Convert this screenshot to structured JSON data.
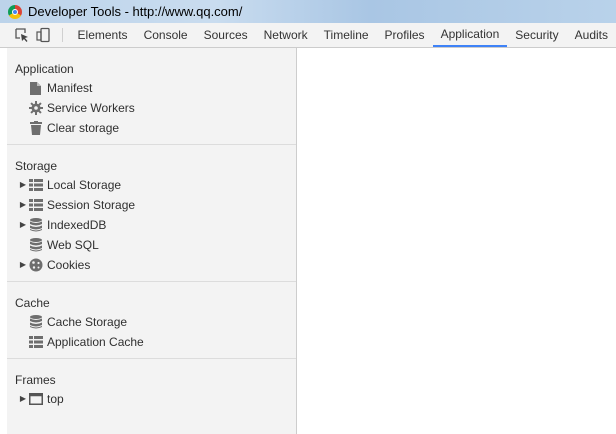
{
  "window": {
    "title": "Developer Tools - http://www.qq.com/"
  },
  "toolbar": {
    "tabs": [
      {
        "label": "Elements"
      },
      {
        "label": "Console"
      },
      {
        "label": "Sources"
      },
      {
        "label": "Network"
      },
      {
        "label": "Timeline"
      },
      {
        "label": "Profiles"
      },
      {
        "label": "Application"
      },
      {
        "label": "Security"
      },
      {
        "label": "Audits"
      }
    ],
    "active_tab": "Application",
    "accent_color": "#3e82f7"
  },
  "sidebar": {
    "sections": [
      {
        "title": "Application",
        "items": [
          {
            "label": "Manifest",
            "icon": "document-icon",
            "expandable": false
          },
          {
            "label": "Service Workers",
            "icon": "gear-icon",
            "expandable": false
          },
          {
            "label": "Clear storage",
            "icon": "trash-icon",
            "expandable": false
          }
        ]
      },
      {
        "title": "Storage",
        "items": [
          {
            "label": "Local Storage",
            "icon": "grid-icon",
            "expandable": true
          },
          {
            "label": "Session Storage",
            "icon": "grid-icon",
            "expandable": true
          },
          {
            "label": "IndexedDB",
            "icon": "database-icon",
            "expandable": true
          },
          {
            "label": "Web SQL",
            "icon": "database-icon",
            "expandable": false
          },
          {
            "label": "Cookies",
            "icon": "cookie-icon",
            "expandable": true
          }
        ]
      },
      {
        "title": "Cache",
        "items": [
          {
            "label": "Cache Storage",
            "icon": "database-icon",
            "expandable": false
          },
          {
            "label": "Application Cache",
            "icon": "grid-icon",
            "expandable": false
          }
        ]
      },
      {
        "title": "Frames",
        "items": [
          {
            "label": "top",
            "icon": "frame-icon",
            "expandable": true
          }
        ]
      }
    ]
  }
}
